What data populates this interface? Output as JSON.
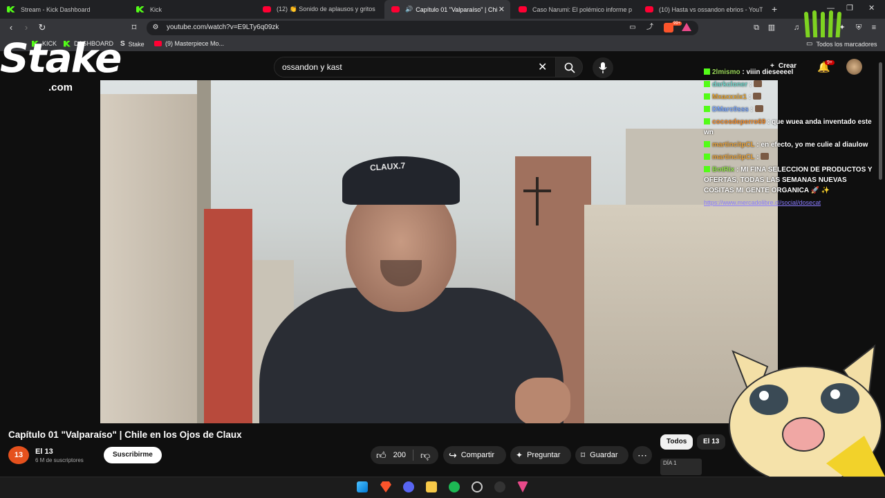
{
  "browser": {
    "tabs": [
      {
        "title": "Stream - Kick Dashboard",
        "favicon": "kick",
        "active": false
      },
      {
        "title": "Kick",
        "favicon": "kick",
        "active": false
      },
      {
        "title": "(12) 👏 Sonido de aplausos y gritos",
        "favicon": "youtube",
        "active": false
      },
      {
        "title": "Capítulo 01 \"Valparaíso\" | Chi",
        "favicon": "youtube",
        "active": true
      },
      {
        "title": "Caso Narumi: El polémico informe p",
        "favicon": "youtube",
        "active": false
      },
      {
        "title": "(10) Hasta vs ossandon ebrios - YouT",
        "favicon": "youtube",
        "active": false
      }
    ],
    "new_tab": "+",
    "url": "youtube.com/watch?v=E9LTy6q09zk",
    "bookmarks": [
      {
        "label": "KICK",
        "favicon": "kick"
      },
      {
        "label": "DASHBOARD",
        "favicon": "kick"
      },
      {
        "label": "Stake",
        "favicon": "stake"
      },
      {
        "label": "(9) Masterpiece Mo...",
        "favicon": "youtube"
      }
    ],
    "all_bookmarks": "Todos los marcadores",
    "brave_badge": "99+"
  },
  "youtube": {
    "search_value": "ossandon y kast",
    "create_label": "Crear",
    "notif_count": "9+",
    "video_title": "Capítulo 01 \"Valparaíso\" | Chile en los Ojos de Claux",
    "channel_name": "El 13",
    "channel_initials": "13",
    "subscribers": "6 M de suscriptores",
    "subscribe_label": "Suscribirme",
    "likes": "200",
    "share_label": "Compartir",
    "ask_label": "Preguntar",
    "save_label": "Guardar",
    "chips": [
      "Todos",
      "El 13"
    ],
    "cap_text": "CLAUX.7"
  },
  "overlay": {
    "stake_logo": "Stake",
    "stake_sub": ".com",
    "chat": [
      {
        "user": "2lmismo",
        "color": "#9bd95a",
        "text": "viiin dieseeeel"
      },
      {
        "user": "darkcloner",
        "color": "#6fd3c8",
        "text": ""
      },
      {
        "user": "Mxaxxxix1",
        "color": "#e0a030",
        "text": ""
      },
      {
        "user": "DMarc0sss",
        "color": "#7aa8ff",
        "text": ""
      },
      {
        "user": "cocosdeperro69",
        "color": "#f08a2a",
        "text": "que wuea anda inventado este wn"
      },
      {
        "user": "martincitpCL",
        "color": "#e7a23b",
        "text": "en efecto, yo me culie al diaulow"
      },
      {
        "user": "martincitpCL",
        "color": "#e7a23b",
        "text": ""
      },
      {
        "user": "BotRix",
        "color": "#8fe04a",
        "text": "MI FINA SELECCION DE PRODUCTOS Y OFERTAS, TODAS LAS SEMANAS NUEVAS COSITAS MI GENTE ORGANICA 🚀 ✨"
      }
    ],
    "chat_link": "https://www.mercadolibre.cl/social/dosecat",
    "streamer_label": "DÍA 1"
  }
}
